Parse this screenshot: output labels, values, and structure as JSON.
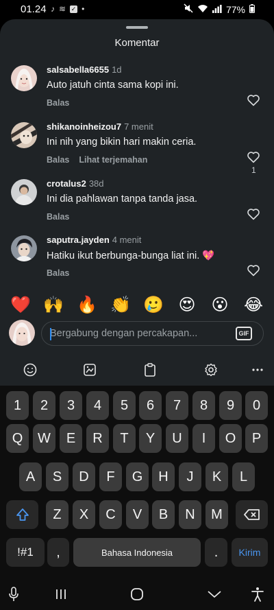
{
  "status_bar": {
    "time": "01.24",
    "battery": "77%"
  },
  "sheet": {
    "title": "Komentar"
  },
  "comments": [
    {
      "user": "salsabella6655",
      "time": "1d",
      "text": "Auto jatuh cinta sama kopi ini.",
      "reply": "Balas",
      "translate": "",
      "likes": ""
    },
    {
      "user": "shikanoinheizou7",
      "time": "7 menit",
      "text": "Ini nih yang bikin hari makin ceria.",
      "reply": "Balas",
      "translate": "Lihat terjemahan",
      "likes": "1"
    },
    {
      "user": "crotalus2",
      "time": "38d",
      "text": "Ini dia pahlawan tanpa tanda jasa.",
      "reply": "Balas",
      "translate": "",
      "likes": ""
    },
    {
      "user": "saputra.jayden",
      "time": "4 menit",
      "text": "Hatiku ikut berbunga-bunga liat ini. 💖",
      "reply": "Balas",
      "translate": "",
      "likes": ""
    }
  ],
  "emoji_bar": [
    "❤️",
    "🙌",
    "🔥",
    "👏",
    "🥲",
    "😍",
    "😮",
    "😂"
  ],
  "composer": {
    "placeholder": "Bergabung dengan percakapan...",
    "gif_label": "GIF"
  },
  "keyboard": {
    "row_numbers": [
      "1",
      "2",
      "3",
      "4",
      "5",
      "6",
      "7",
      "8",
      "9",
      "0"
    ],
    "row1": [
      "Q",
      "W",
      "E",
      "R",
      "T",
      "Y",
      "U",
      "I",
      "O",
      "P"
    ],
    "row2": [
      "A",
      "S",
      "D",
      "F",
      "G",
      "H",
      "J",
      "K",
      "L"
    ],
    "row3": [
      "Z",
      "X",
      "C",
      "V",
      "B",
      "N",
      "M"
    ],
    "symbols_key": "!#1",
    "comma_key": ",",
    "space_label": "Bahasa Indonesia",
    "period_key": ".",
    "enter_label": "Kirim"
  }
}
